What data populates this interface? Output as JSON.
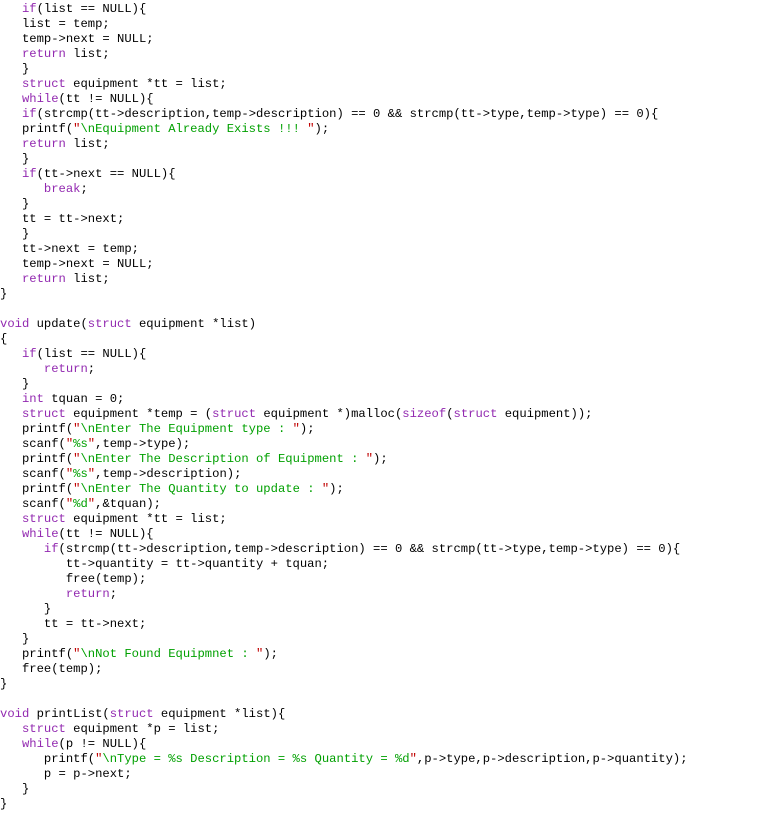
{
  "editor": {
    "language": "C",
    "background_color": "#ffffff",
    "default_text_color": "#000000",
    "keyword_color": "#9229b0",
    "string_color": "#00a000",
    "quote_color": "#c00000",
    "font_size_px": 12,
    "line_height_px": 15,
    "total_lines": 55
  },
  "code": {
    "lines": [
      [
        {
          "t": "plain",
          "v": "   "
        },
        {
          "t": "keyword",
          "v": "if"
        },
        {
          "t": "plain",
          "v": "(list == NULL){"
        }
      ],
      [
        {
          "t": "plain",
          "v": "   list = temp;"
        }
      ],
      [
        {
          "t": "plain",
          "v": "   temp->next = NULL;"
        }
      ],
      [
        {
          "t": "plain",
          "v": "   "
        },
        {
          "t": "keyword",
          "v": "return"
        },
        {
          "t": "plain",
          "v": " list;"
        }
      ],
      [
        {
          "t": "plain",
          "v": "   }"
        }
      ],
      [
        {
          "t": "plain",
          "v": "   "
        },
        {
          "t": "keyword",
          "v": "struct"
        },
        {
          "t": "plain",
          "v": " equipment *tt = list;"
        }
      ],
      [
        {
          "t": "plain",
          "v": "   "
        },
        {
          "t": "keyword",
          "v": "while"
        },
        {
          "t": "plain",
          "v": "(tt != NULL){"
        }
      ],
      [
        {
          "t": "plain",
          "v": "   "
        },
        {
          "t": "keyword",
          "v": "if"
        },
        {
          "t": "plain",
          "v": "(strcmp(tt->description,temp->description) == 0 && strcmp(tt->type,temp->type) == 0){"
        }
      ],
      [
        {
          "t": "plain",
          "v": "   printf("
        },
        {
          "t": "quote",
          "v": "\""
        },
        {
          "t": "string",
          "v": "\\nEquipment Already Exists !!! "
        },
        {
          "t": "quote",
          "v": "\""
        },
        {
          "t": "plain",
          "v": ");"
        }
      ],
      [
        {
          "t": "plain",
          "v": "   "
        },
        {
          "t": "keyword",
          "v": "return"
        },
        {
          "t": "plain",
          "v": " list;"
        }
      ],
      [
        {
          "t": "plain",
          "v": "   }"
        }
      ],
      [
        {
          "t": "plain",
          "v": "   "
        },
        {
          "t": "keyword",
          "v": "if"
        },
        {
          "t": "plain",
          "v": "(tt->next == NULL){"
        }
      ],
      [
        {
          "t": "plain",
          "v": "      "
        },
        {
          "t": "keyword",
          "v": "break"
        },
        {
          "t": "plain",
          "v": ";"
        }
      ],
      [
        {
          "t": "plain",
          "v": "   }"
        }
      ],
      [
        {
          "t": "plain",
          "v": "   tt = tt->next;"
        }
      ],
      [
        {
          "t": "plain",
          "v": "   }"
        }
      ],
      [
        {
          "t": "plain",
          "v": "   tt->next = temp;"
        }
      ],
      [
        {
          "t": "plain",
          "v": "   temp->next = NULL;"
        }
      ],
      [
        {
          "t": "plain",
          "v": "   "
        },
        {
          "t": "keyword",
          "v": "return"
        },
        {
          "t": "plain",
          "v": " list;"
        }
      ],
      [
        {
          "t": "plain",
          "v": "}"
        }
      ],
      [
        {
          "t": "blank",
          "v": ""
        }
      ],
      [
        {
          "t": "keyword",
          "v": "void"
        },
        {
          "t": "plain",
          "v": " update("
        },
        {
          "t": "keyword",
          "v": "struct"
        },
        {
          "t": "plain",
          "v": " equipment *list)"
        }
      ],
      [
        {
          "t": "plain",
          "v": "{"
        }
      ],
      [
        {
          "t": "plain",
          "v": "   "
        },
        {
          "t": "keyword",
          "v": "if"
        },
        {
          "t": "plain",
          "v": "(list == NULL){"
        }
      ],
      [
        {
          "t": "plain",
          "v": "      "
        },
        {
          "t": "keyword",
          "v": "return"
        },
        {
          "t": "plain",
          "v": ";"
        }
      ],
      [
        {
          "t": "plain",
          "v": "   }"
        }
      ],
      [
        {
          "t": "plain",
          "v": "   "
        },
        {
          "t": "keyword",
          "v": "int"
        },
        {
          "t": "plain",
          "v": " tquan = 0;"
        }
      ],
      [
        {
          "t": "plain",
          "v": "   "
        },
        {
          "t": "keyword",
          "v": "struct"
        },
        {
          "t": "plain",
          "v": " equipment *temp = ("
        },
        {
          "t": "keyword",
          "v": "struct"
        },
        {
          "t": "plain",
          "v": " equipment *)malloc("
        },
        {
          "t": "keyword",
          "v": "sizeof"
        },
        {
          "t": "plain",
          "v": "("
        },
        {
          "t": "keyword",
          "v": "struct"
        },
        {
          "t": "plain",
          "v": " equipment));"
        }
      ],
      [
        {
          "t": "plain",
          "v": "   printf("
        },
        {
          "t": "quote",
          "v": "\""
        },
        {
          "t": "string",
          "v": "\\nEnter The Equipment type : "
        },
        {
          "t": "quote",
          "v": "\""
        },
        {
          "t": "plain",
          "v": ");"
        }
      ],
      [
        {
          "t": "plain",
          "v": "   scanf("
        },
        {
          "t": "quote",
          "v": "\""
        },
        {
          "t": "string",
          "v": "%s"
        },
        {
          "t": "quote",
          "v": "\""
        },
        {
          "t": "plain",
          "v": ",temp->type);"
        }
      ],
      [
        {
          "t": "plain",
          "v": "   printf("
        },
        {
          "t": "quote",
          "v": "\""
        },
        {
          "t": "string",
          "v": "\\nEnter The Description of Equipment : "
        },
        {
          "t": "quote",
          "v": "\""
        },
        {
          "t": "plain",
          "v": ");"
        }
      ],
      [
        {
          "t": "plain",
          "v": "   scanf("
        },
        {
          "t": "quote",
          "v": "\""
        },
        {
          "t": "string",
          "v": "%s"
        },
        {
          "t": "quote",
          "v": "\""
        },
        {
          "t": "plain",
          "v": ",temp->description);"
        }
      ],
      [
        {
          "t": "plain",
          "v": "   printf("
        },
        {
          "t": "quote",
          "v": "\""
        },
        {
          "t": "string",
          "v": "\\nEnter The Quantity to update : "
        },
        {
          "t": "quote",
          "v": "\""
        },
        {
          "t": "plain",
          "v": ");"
        }
      ],
      [
        {
          "t": "plain",
          "v": "   scanf("
        },
        {
          "t": "quote",
          "v": "\""
        },
        {
          "t": "string",
          "v": "%d"
        },
        {
          "t": "quote",
          "v": "\""
        },
        {
          "t": "plain",
          "v": ",&tquan);"
        }
      ],
      [
        {
          "t": "plain",
          "v": "   "
        },
        {
          "t": "keyword",
          "v": "struct"
        },
        {
          "t": "plain",
          "v": " equipment *tt = list;"
        }
      ],
      [
        {
          "t": "plain",
          "v": "   "
        },
        {
          "t": "keyword",
          "v": "while"
        },
        {
          "t": "plain",
          "v": "(tt != NULL){"
        }
      ],
      [
        {
          "t": "plain",
          "v": "      "
        },
        {
          "t": "keyword",
          "v": "if"
        },
        {
          "t": "plain",
          "v": "(strcmp(tt->description,temp->description) == 0 && strcmp(tt->type,temp->type) == 0){"
        }
      ],
      [
        {
          "t": "plain",
          "v": "         tt->quantity = tt->quantity + tquan;"
        }
      ],
      [
        {
          "t": "plain",
          "v": "         free(temp);"
        }
      ],
      [
        {
          "t": "plain",
          "v": "         "
        },
        {
          "t": "keyword",
          "v": "return"
        },
        {
          "t": "plain",
          "v": ";"
        }
      ],
      [
        {
          "t": "plain",
          "v": "      }"
        }
      ],
      [
        {
          "t": "plain",
          "v": "      tt = tt->next;"
        }
      ],
      [
        {
          "t": "plain",
          "v": "   }"
        }
      ],
      [
        {
          "t": "plain",
          "v": "   printf("
        },
        {
          "t": "quote",
          "v": "\""
        },
        {
          "t": "string",
          "v": "\\nNot Found Equipmnet : "
        },
        {
          "t": "quote",
          "v": "\""
        },
        {
          "t": "plain",
          "v": ");"
        }
      ],
      [
        {
          "t": "plain",
          "v": "   free(temp);"
        }
      ],
      [
        {
          "t": "plain",
          "v": "}"
        }
      ],
      [
        {
          "t": "blank",
          "v": ""
        }
      ],
      [
        {
          "t": "keyword",
          "v": "void"
        },
        {
          "t": "plain",
          "v": " printList("
        },
        {
          "t": "keyword",
          "v": "struct"
        },
        {
          "t": "plain",
          "v": " equipment *list){"
        }
      ],
      [
        {
          "t": "plain",
          "v": "   "
        },
        {
          "t": "keyword",
          "v": "struct"
        },
        {
          "t": "plain",
          "v": " equipment *p = list;"
        }
      ],
      [
        {
          "t": "plain",
          "v": "   "
        },
        {
          "t": "keyword",
          "v": "while"
        },
        {
          "t": "plain",
          "v": "(p != NULL){"
        }
      ],
      [
        {
          "t": "plain",
          "v": "      printf("
        },
        {
          "t": "quote",
          "v": "\""
        },
        {
          "t": "string",
          "v": "\\nType = %s Description = %s Quantity = %d"
        },
        {
          "t": "quote",
          "v": "\""
        },
        {
          "t": "plain",
          "v": ",p->type,p->description,p->quantity);"
        }
      ],
      [
        {
          "t": "plain",
          "v": "      p = p->next;"
        }
      ],
      [
        {
          "t": "plain",
          "v": "   }"
        }
      ],
      [
        {
          "t": "plain",
          "v": "}"
        }
      ],
      [
        {
          "t": "blank",
          "v": ""
        }
      ]
    ]
  }
}
